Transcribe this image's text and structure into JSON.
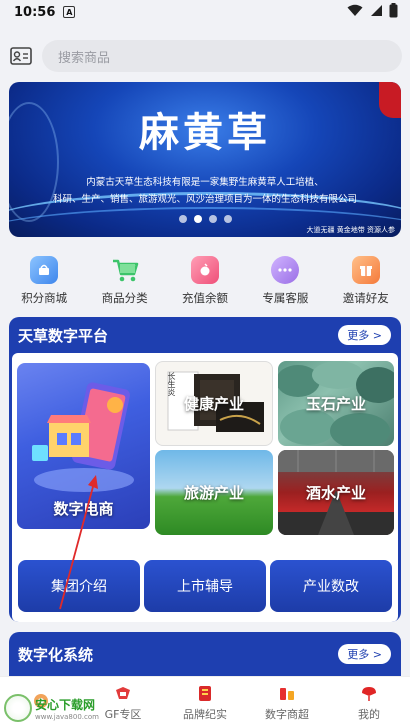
{
  "status_bar": {
    "time": "10:56",
    "notif_glyph": "A"
  },
  "search": {
    "placeholder": "搜索商品"
  },
  "banner": {
    "title": "麻黄草",
    "subtitle_line1": "内蒙古天草生态科技有限是一家集野生麻黄草人工培植、",
    "subtitle_line2": "科研、生产、销售、旅游观光、风沙治理项目为一体的生态科技有限公司",
    "footer": "大道无疆 黄金地带 资源人参",
    "active_dot": 1
  },
  "quick_actions": [
    {
      "label": "积分商城",
      "icon": "points-mall-icon",
      "color": "#5aa0f0"
    },
    {
      "label": "商品分类",
      "icon": "cart-icon",
      "color": "#3cc46a"
    },
    {
      "label": "充值余额",
      "icon": "recharge-icon",
      "color": "#f06a8a"
    },
    {
      "label": "专属客服",
      "icon": "chat-icon",
      "color": "#a07ae8"
    },
    {
      "label": "邀请好友",
      "icon": "invite-icon",
      "color": "#f5874a"
    }
  ],
  "platform": {
    "title": "天草数字平台",
    "more": "更多 >",
    "tiles": {
      "ecommerce": "数字电商",
      "health": "健康产业",
      "jade": "玉石产业",
      "tourism": "旅游产业",
      "wine": "酒水产业",
      "health_box_text": "长生炎"
    },
    "buttons": [
      "集团介绍",
      "上市辅导",
      "产业数改"
    ]
  },
  "system": {
    "title": "数字化系统",
    "more": "更多 >"
  },
  "tabbar": {
    "items": [
      {
        "label": "",
        "icon": "home-icon"
      },
      {
        "label": "GF专区",
        "icon": "gf-zone-icon"
      },
      {
        "label": "品牌纪实",
        "icon": "brand-icon"
      },
      {
        "label": "数字商超",
        "icon": "digital-mall-icon"
      },
      {
        "label": "我的",
        "icon": "profile-icon"
      }
    ]
  },
  "watermark": {
    "name": "安心下载网",
    "url": "www.java800.com"
  }
}
